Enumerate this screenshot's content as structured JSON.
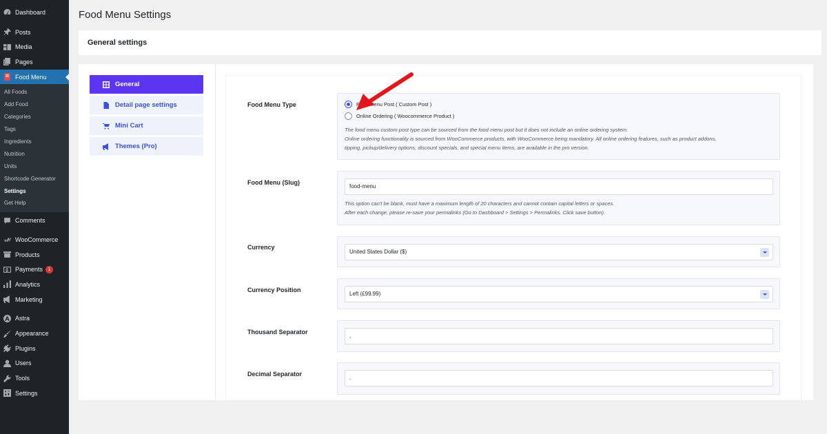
{
  "sidebar": {
    "items_top": [
      {
        "label": "Dashboard",
        "icon": "dashboard-icon"
      },
      {
        "label": "Posts",
        "icon": "pin-icon"
      },
      {
        "label": "Media",
        "icon": "media-icon"
      },
      {
        "label": "Pages",
        "icon": "pages-icon"
      },
      {
        "label": "Food Menu",
        "icon": "food-menu-icon"
      }
    ],
    "submenu": [
      "All Foods",
      "Add Food",
      "Categories",
      "Tags",
      "Ingredients",
      "Nutrition",
      "Units",
      "Shortcode Generator",
      "Settings",
      "Get Help"
    ],
    "items_bottom": [
      {
        "label": "Comments",
        "icon": "comments-icon"
      },
      {
        "label": "WooCommerce",
        "icon": "woocommerce-icon"
      },
      {
        "label": "Products",
        "icon": "products-icon"
      },
      {
        "label": "Payments",
        "icon": "payments-icon",
        "badge": "1"
      },
      {
        "label": "Analytics",
        "icon": "analytics-icon"
      },
      {
        "label": "Marketing",
        "icon": "marketing-icon"
      },
      {
        "label": "Astra",
        "icon": "astra-icon"
      },
      {
        "label": "Appearance",
        "icon": "appearance-icon"
      },
      {
        "label": "Plugins",
        "icon": "plugins-icon"
      },
      {
        "label": "Users",
        "icon": "users-icon"
      },
      {
        "label": "Tools",
        "icon": "tools-icon"
      },
      {
        "label": "Settings",
        "icon": "settings-icon"
      }
    ]
  },
  "header": {
    "title": "Food Menu Settings",
    "section_title": "General settings"
  },
  "tabs": [
    {
      "label": "General",
      "icon": "grid-icon"
    },
    {
      "label": "Detail page settings",
      "icon": "document-icon"
    },
    {
      "label": "Mini Cart",
      "icon": "cart-icon"
    },
    {
      "label": "Themes (Pro)",
      "icon": "megaphone-icon"
    }
  ],
  "fields": {
    "food_menu_type": {
      "label": "Food Menu Type",
      "option1": "Food Menu Post ( Custom Post )",
      "option2": "Online Ordering ( Woocommerce Product )",
      "selected": "option1",
      "desc1": "The food menu custom post type can be sourced from the food menu post but it does not include an online ordering system.",
      "desc2": "Online ordering functionality is sourced from WooCommerce products, with WooCommerce being mandatory. All online ordering features, such as product addons,",
      "desc3": "tipping, pickup/delivery options, discount specials, and special menu items, are available in the pro version."
    },
    "slug": {
      "label": "Food Menu (Slug)",
      "value": "food-menu",
      "desc1": "This option can't be blank, must have a maximum length of 20 characters and cannot contain capital letters or spaces.",
      "desc2": "After each change, please re-save your permalinks (Go to Dashboard > Settings > Permalinks. Click save button)."
    },
    "currency": {
      "label": "Currency",
      "value": "United States Dollar ($)"
    },
    "currency_position": {
      "label": "Currency Position",
      "value": "Left (£99.99)"
    },
    "thousand_separator": {
      "label": "Thousand Separator",
      "value": ","
    },
    "decimal_separator": {
      "label": "Decimal Separator",
      "value": "."
    }
  },
  "colors": {
    "accent": "#5b35f2",
    "wp_admin_blue": "#2271b1",
    "annotation_arrow": "#e3171b"
  }
}
